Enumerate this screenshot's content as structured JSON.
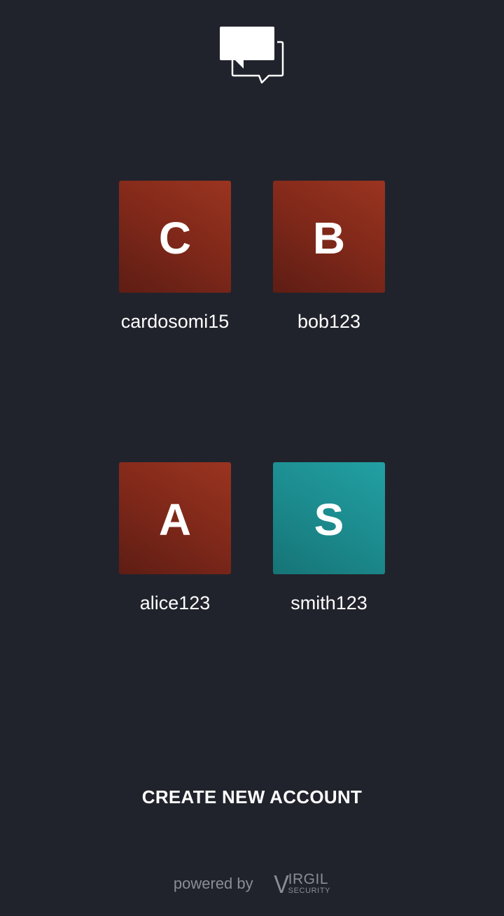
{
  "app": {
    "logo_icon": "chat-bubbles-icon"
  },
  "accounts": [
    {
      "initial": "C",
      "username": "cardosomi15",
      "color": "#82291a"
    },
    {
      "initial": "B",
      "username": "bob123",
      "color": "#82291a"
    },
    {
      "initial": "A",
      "username": "alice123",
      "color": "#82291a"
    },
    {
      "initial": "S",
      "username": "smith123",
      "color": "#1c8b8e"
    }
  ],
  "actions": {
    "create_account_label": "CREATE NEW ACCOUNT"
  },
  "footer": {
    "powered_by": "powered by",
    "brand_v": "V",
    "brand_name": "IRGIL",
    "brand_sub": "SECURITY"
  },
  "colors": {
    "background": "#21232c",
    "text": "#ffffff",
    "muted": "#8a8d96"
  }
}
